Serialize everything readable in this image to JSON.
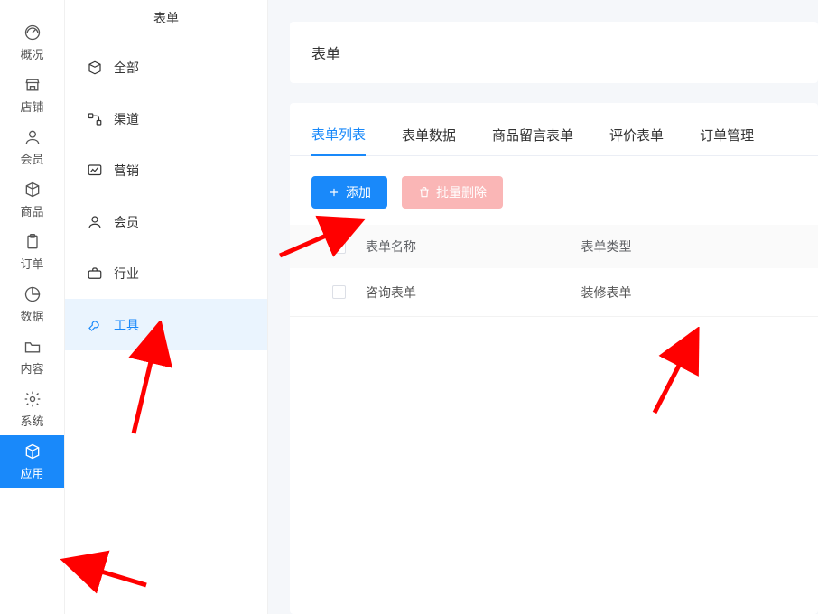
{
  "primary_sidebar": {
    "items": [
      {
        "label": "概况"
      },
      {
        "label": "店铺"
      },
      {
        "label": "会员"
      },
      {
        "label": "商品"
      },
      {
        "label": "订单"
      },
      {
        "label": "数据"
      },
      {
        "label": "内容"
      },
      {
        "label": "系统"
      },
      {
        "label": "应用"
      }
    ]
  },
  "secondary_sidebar": {
    "header": "表单",
    "items": [
      {
        "label": "全部"
      },
      {
        "label": "渠道"
      },
      {
        "label": "营销"
      },
      {
        "label": "会员"
      },
      {
        "label": "行业"
      },
      {
        "label": "工具"
      }
    ]
  },
  "page": {
    "title": "表单"
  },
  "tabs": [
    {
      "label": "表单列表"
    },
    {
      "label": "表单数据"
    },
    {
      "label": "商品留言表单"
    },
    {
      "label": "评价表单"
    },
    {
      "label": "订单管理"
    }
  ],
  "toolbar": {
    "add_label": "添加",
    "batch_delete_label": "批量删除"
  },
  "table": {
    "headers": {
      "name": "表单名称",
      "type": "表单类型"
    },
    "rows": [
      {
        "name": "咨询表单",
        "type": "装修表单"
      }
    ]
  },
  "colors": {
    "primary": "#1989fa",
    "primary_light_bg": "#eaf4fe",
    "danger_soft": "#fab6b6",
    "annotation_red": "#ff0000"
  }
}
